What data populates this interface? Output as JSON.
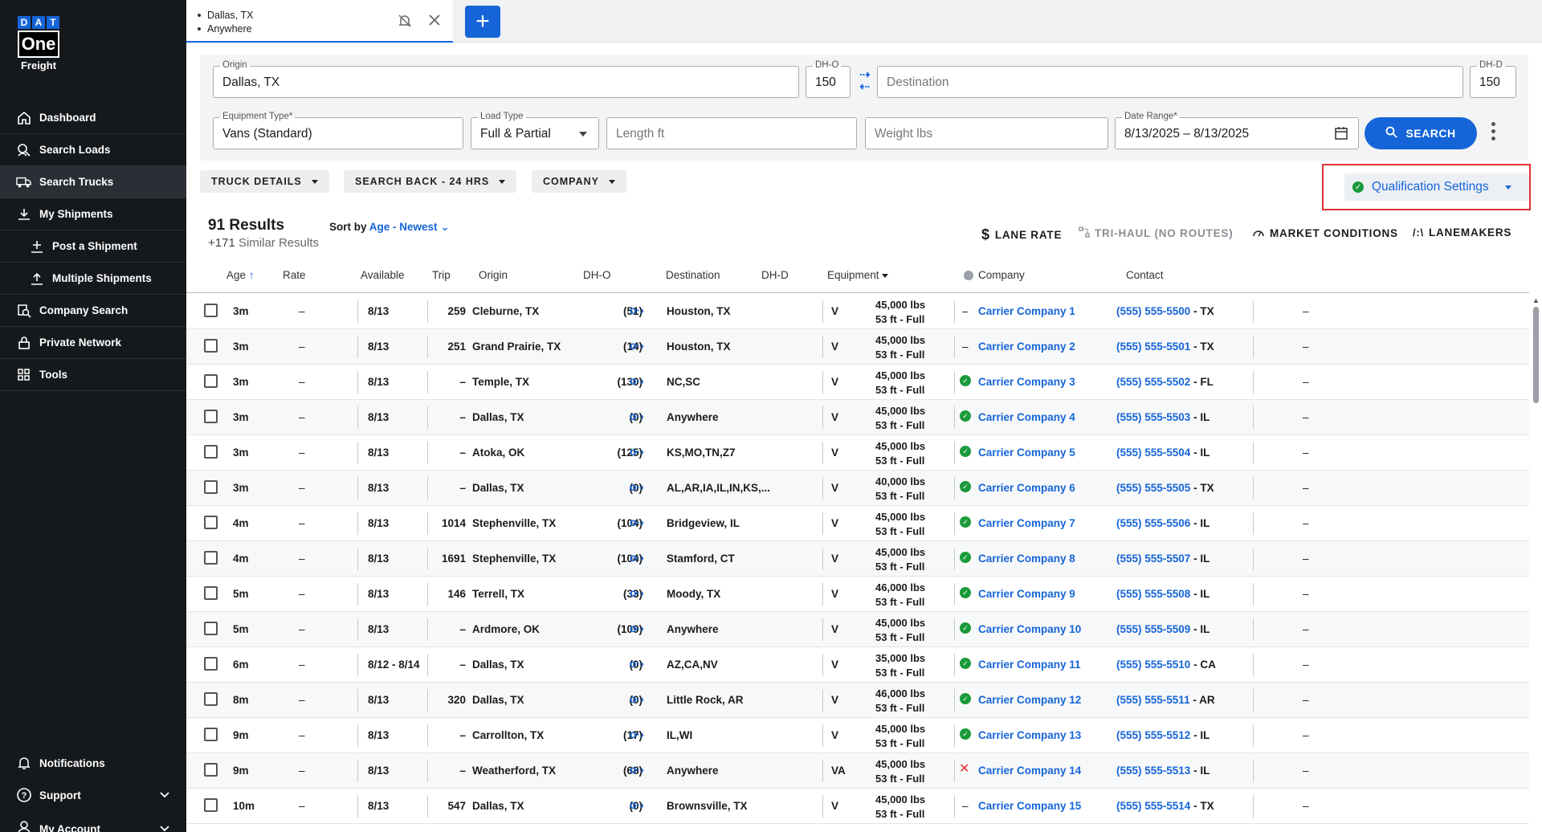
{
  "brand": {
    "dat": [
      "D",
      "A",
      "T"
    ],
    "one": "One",
    "freight": "Freight"
  },
  "nav": {
    "items": [
      {
        "label": "Dashboard",
        "icon": "home-icon"
      },
      {
        "label": "Search Loads",
        "icon": "search-icon"
      },
      {
        "label": "Search Trucks",
        "icon": "truck-icon"
      },
      {
        "label": "My Shipments",
        "icon": "shipment-icon"
      },
      {
        "label": "Post a Shipment",
        "icon": "post-icon"
      },
      {
        "label": "Multiple Shipments",
        "icon": "upload-icon"
      },
      {
        "label": "Company Search",
        "icon": "company-search-icon"
      },
      {
        "label": "Private Network",
        "icon": "lock-icon"
      },
      {
        "label": "Tools",
        "icon": "grid-icon"
      }
    ],
    "bottom": [
      {
        "label": "Notifications"
      },
      {
        "label": "Support"
      },
      {
        "label": "My Account"
      }
    ]
  },
  "tab": {
    "origin": "Dallas, TX",
    "destination": "Anywhere"
  },
  "form": {
    "origin_label": "Origin",
    "origin_value": "Dallas, TX",
    "dho_label": "DH-O",
    "dho_value": "150",
    "destination_placeholder": "Destination",
    "dhd_label": "DH-D",
    "dhd_value": "150",
    "equipment_label": "Equipment Type*",
    "equipment_value": "Vans (Standard)",
    "loadtype_label": "Load Type",
    "loadtype_value": "Full & Partial",
    "length_placeholder": "Length ft",
    "weight_placeholder": "Weight lbs",
    "daterange_label": "Date Range*",
    "daterange_value": "8/13/2025 – 8/13/2025",
    "search_label": "SEARCH"
  },
  "filters": {
    "truck_details": "TRUCK DETAILS",
    "search_back": "SEARCH BACK - 24 HRS",
    "company": "COMPANY",
    "qualification": "Qualification Settings"
  },
  "results": {
    "count": "91 Results",
    "similar_count": "+171",
    "similar_label": "Similar Results",
    "sort_label": "Sort by",
    "sort_value": "Age - Newest",
    "lane_rate": "LANE RATE",
    "tri_haul": "TRI-HAUL (NO ROUTES)",
    "market": "MARKET CONDITIONS",
    "lanemakers": "LANEMAKERS"
  },
  "columns": {
    "age": "Age",
    "rate": "Rate",
    "available": "Available",
    "trip": "Trip",
    "origin": "Origin",
    "dho": "DH-O",
    "destination": "Destination",
    "dhd": "DH-D",
    "equipment": "Equipment",
    "company": "Company",
    "contact": "Contact"
  },
  "rows": [
    {
      "age": "3m",
      "rate": "–",
      "avail": "8/13",
      "trip": "259",
      "origin": "Cleburne, TX",
      "dho": "(51)",
      "dest": "Houston, TX",
      "eq": "V",
      "weight": "45,000 lbs",
      "len": "53 ft - Full",
      "status": "none",
      "company": "Carrier Company 1",
      "phone": "(555) 555-5500",
      "state": "- TX",
      "extra": "–"
    },
    {
      "age": "3m",
      "rate": "–",
      "avail": "8/13",
      "trip": "251",
      "origin": "Grand Prairie, TX",
      "dho": "(14)",
      "dest": "Houston, TX",
      "eq": "V",
      "weight": "45,000 lbs",
      "len": "53 ft - Full",
      "status": "none",
      "company": "Carrier Company 2",
      "phone": "(555) 555-5501",
      "state": "- TX",
      "extra": "–"
    },
    {
      "age": "3m",
      "rate": "–",
      "avail": "8/13",
      "trip": "–",
      "origin": "Temple, TX",
      "dho": "(130)",
      "dest": "NC,SC",
      "eq": "V",
      "weight": "45,000 lbs",
      "len": "53 ft - Full",
      "status": "ok",
      "company": "Carrier Company 3",
      "phone": "(555) 555-5502",
      "state": "- FL",
      "extra": "–"
    },
    {
      "age": "3m",
      "rate": "–",
      "avail": "8/13",
      "trip": "–",
      "origin": "Dallas, TX",
      "dho": "(0)",
      "dest": "Anywhere",
      "eq": "V",
      "weight": "45,000 lbs",
      "len": "53 ft - Full",
      "status": "ok",
      "company": "Carrier Company 4",
      "phone": "(555) 555-5503",
      "state": "- IL",
      "extra": "–"
    },
    {
      "age": "3m",
      "rate": "–",
      "avail": "8/13",
      "trip": "–",
      "origin": "Atoka, OK",
      "dho": "(125)",
      "dest": "KS,MO,TN,Z7",
      "eq": "V",
      "weight": "45,000 lbs",
      "len": "53 ft - Full",
      "status": "ok",
      "company": "Carrier Company 5",
      "phone": "(555) 555-5504",
      "state": "- IL",
      "extra": "–"
    },
    {
      "age": "3m",
      "rate": "–",
      "avail": "8/13",
      "trip": "–",
      "origin": "Dallas, TX",
      "dho": "(0)",
      "dest": "AL,AR,IA,IL,IN,KS,...",
      "eq": "V",
      "weight": "40,000 lbs",
      "len": "53 ft - Full",
      "status": "ok",
      "company": "Carrier Company 6",
      "phone": "(555) 555-5505",
      "state": "- TX",
      "extra": "–"
    },
    {
      "age": "4m",
      "rate": "–",
      "avail": "8/13",
      "trip": "1014",
      "origin": "Stephenville, TX",
      "dho": "(104)",
      "dest": "Bridgeview, IL",
      "eq": "V",
      "weight": "45,000 lbs",
      "len": "53 ft - Full",
      "status": "ok",
      "company": "Carrier Company 7",
      "phone": "(555) 555-5506",
      "state": "- IL",
      "extra": "–"
    },
    {
      "age": "4m",
      "rate": "–",
      "avail": "8/13",
      "trip": "1691",
      "origin": "Stephenville, TX",
      "dho": "(104)",
      "dest": "Stamford, CT",
      "eq": "V",
      "weight": "45,000 lbs",
      "len": "53 ft - Full",
      "status": "ok",
      "company": "Carrier Company 8",
      "phone": "(555) 555-5507",
      "state": "- IL",
      "extra": "–"
    },
    {
      "age": "5m",
      "rate": "–",
      "avail": "8/13",
      "trip": "146",
      "origin": "Terrell, TX",
      "dho": "(33)",
      "dest": "Moody, TX",
      "eq": "V",
      "weight": "46,000 lbs",
      "len": "53 ft - Full",
      "status": "ok",
      "company": "Carrier Company 9",
      "phone": "(555) 555-5508",
      "state": "- IL",
      "extra": "–"
    },
    {
      "age": "5m",
      "rate": "–",
      "avail": "8/13",
      "trip": "–",
      "origin": "Ardmore, OK",
      "dho": "(109)",
      "dest": "Anywhere",
      "eq": "V",
      "weight": "45,000 lbs",
      "len": "53 ft - Full",
      "status": "ok",
      "company": "Carrier Company 10",
      "phone": "(555) 555-5509",
      "state": "- IL",
      "extra": "–"
    },
    {
      "age": "6m",
      "rate": "–",
      "avail": "8/12 - 8/14",
      "trip": "–",
      "origin": "Dallas, TX",
      "dho": "(0)",
      "dest": "AZ,CA,NV",
      "eq": "V",
      "weight": "35,000 lbs",
      "len": "53 ft - Full",
      "status": "ok",
      "company": "Carrier Company 11",
      "phone": "(555) 555-5510",
      "state": "- CA",
      "extra": "–"
    },
    {
      "age": "8m",
      "rate": "–",
      "avail": "8/13",
      "trip": "320",
      "origin": "Dallas, TX",
      "dho": "(0)",
      "dest": "Little Rock, AR",
      "eq": "V",
      "weight": "46,000 lbs",
      "len": "53 ft - Full",
      "status": "ok",
      "company": "Carrier Company 12",
      "phone": "(555) 555-5511",
      "state": "- AR",
      "extra": "–"
    },
    {
      "age": "9m",
      "rate": "–",
      "avail": "8/13",
      "trip": "–",
      "origin": "Carrollton, TX",
      "dho": "(17)",
      "dest": "IL,WI",
      "eq": "V",
      "weight": "45,000 lbs",
      "len": "53 ft - Full",
      "status": "ok",
      "company": "Carrier Company 13",
      "phone": "(555) 555-5512",
      "state": "- IL",
      "extra": "–"
    },
    {
      "age": "9m",
      "rate": "–",
      "avail": "8/13",
      "trip": "–",
      "origin": "Weatherford, TX",
      "dho": "(68)",
      "dest": "Anywhere",
      "eq": "VA",
      "weight": "45,000 lbs",
      "len": "53 ft - Full",
      "status": "fail",
      "company": "Carrier Company 14",
      "phone": "(555) 555-5513",
      "state": "- IL",
      "extra": "–"
    },
    {
      "age": "10m",
      "rate": "–",
      "avail": "8/13",
      "trip": "547",
      "origin": "Dallas, TX",
      "dho": "(0)",
      "dest": "Brownsville, TX",
      "eq": "V",
      "weight": "45,000 lbs",
      "len": "53 ft - Full",
      "status": "none",
      "company": "Carrier Company 15",
      "phone": "(555) 555-5514",
      "state": "- TX",
      "extra": "–"
    }
  ]
}
